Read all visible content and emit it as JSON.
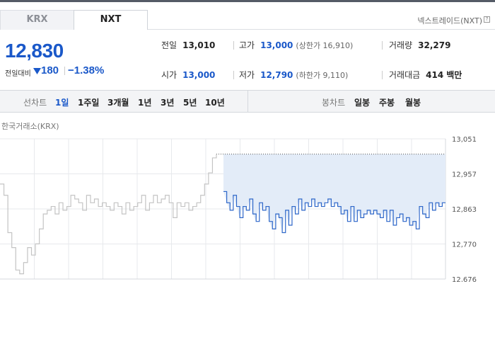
{
  "tabs": [
    {
      "label": "KRX",
      "active": false
    },
    {
      "label": "NXT",
      "active": true
    }
  ],
  "nxt_link": "넥스트레이드(NXT)",
  "help_icon": "?",
  "price": "12,830",
  "change": {
    "label": "전일대비",
    "direction": "down",
    "amount": "180",
    "percent": "−1.38%"
  },
  "stats": {
    "prev_close": {
      "label": "전일",
      "value": "13,010"
    },
    "high": {
      "label": "고가",
      "value": "13,000",
      "sub": "(상한가 16,910)"
    },
    "volume": {
      "label": "거래량",
      "value": "32,279"
    },
    "open": {
      "label": "시가",
      "value": "13,000"
    },
    "low": {
      "label": "저가",
      "value": "12,790",
      "sub": "(하한가 9,110)"
    },
    "amount": {
      "label": "거래대금",
      "value": "414",
      "unit": "백만"
    }
  },
  "period_bar": {
    "line_label": "선차트",
    "line_periods": [
      "1일",
      "1주일",
      "3개월",
      "1년",
      "3년",
      "5년",
      "10년"
    ],
    "active_period": "1일",
    "candle_label": "봉차트",
    "candle_periods": [
      "일봉",
      "주봉",
      "월봉"
    ]
  },
  "chart_source_label": "한국거래소(KRX)",
  "colors": {
    "accent_blue": "#1a58c9",
    "krx_line": "#c4c4c4",
    "nxt_line": "#2e67c9",
    "nxt_fill": "#e3ecf8",
    "grid": "#e7e9ec"
  },
  "chart_data": {
    "type": "line",
    "y_ticks": [
      "13,051",
      "12,957",
      "12,863",
      "12,770",
      "12,676"
    ],
    "ylim": [
      12676,
      13051
    ],
    "prev_close": 13010,
    "grid": true,
    "series": [
      {
        "values": [
          12930,
          12900,
          12800,
          12760,
          12700,
          12690,
          12720,
          12760,
          12740,
          12770,
          12810,
          12850,
          12860,
          12870,
          12850,
          12880,
          12860,
          12870,
          12900,
          12890,
          12880,
          12860,
          12900,
          12880,
          12890,
          12870,
          12880,
          12870,
          12860,
          12880,
          12870,
          12850,
          12880,
          12860,
          12870,
          12880,
          12900,
          12860,
          12880,
          12900,
          12880,
          12890,
          12900,
          12880,
          12840,
          12880,
          12870,
          12880,
          12860,
          12870,
          12880,
          12900,
          12930,
          12960,
          13000,
          13010
        ]
      },
      {
        "values": [
          12910,
          12880,
          12860,
          12900,
          12870,
          12840,
          12870,
          12860,
          12890,
          12850,
          12830,
          12880,
          12860,
          12870,
          12830,
          12810,
          12850,
          12840,
          12800,
          12860,
          12820,
          12870,
          12850,
          12890,
          12860,
          12880,
          12870,
          12890,
          12870,
          12880,
          12870,
          12880,
          12890,
          12870,
          12880,
          12870,
          12850,
          12860,
          12830,
          12870,
          12830,
          12860,
          12840,
          12850,
          12860,
          12850,
          12860,
          12850,
          12840,
          12860,
          12830,
          12860,
          12820,
          12840,
          12850,
          12830,
          12840,
          12820,
          12830,
          12810,
          12870,
          12850,
          12840,
          12880,
          12860,
          12880,
          12870,
          12880,
          12880
        ]
      }
    ]
  }
}
